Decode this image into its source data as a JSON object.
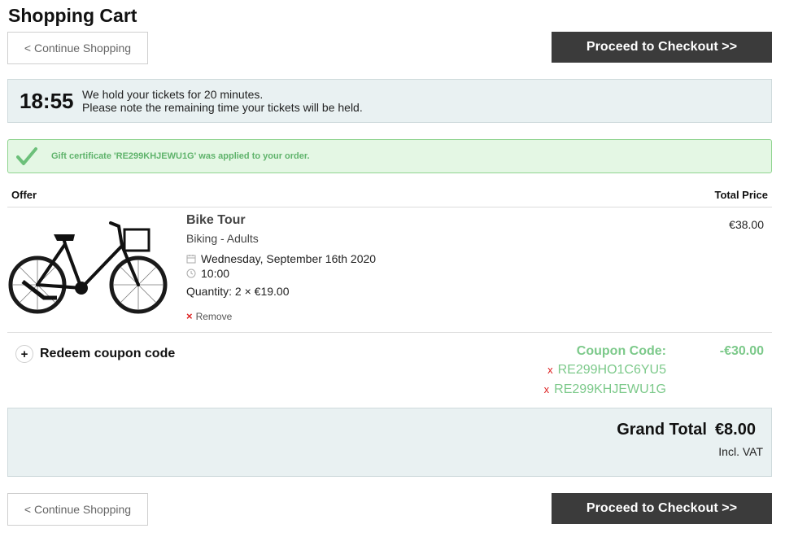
{
  "page": {
    "title": "Shopping Cart"
  },
  "nav": {
    "continue_label": "< Continue Shopping",
    "checkout_label": "Proceed to Checkout >>"
  },
  "timer": {
    "value": "18:55",
    "line1": "We hold your tickets for 20 minutes.",
    "line2": "Please note the remaining time your tickets will be held."
  },
  "alert": {
    "icon": "checkmark-icon",
    "message": "Gift certificate 'RE299KHJEWU1G' was applied to your order."
  },
  "table": {
    "col_offer": "Offer",
    "col_total": "Total Price"
  },
  "item": {
    "image": "bicycle-image",
    "title": "Bike Tour",
    "subtitle": "Biking - Adults",
    "date": "Wednesday, September 16th 2020",
    "time": "10:00",
    "quantity": "Quantity: 2 × €19.00",
    "remove_label": "Remove",
    "price": "€38.00"
  },
  "coupon": {
    "toggle_symbol": "+",
    "toggle_label": "Redeem coupon code",
    "label": "Coupon Code:",
    "amount": "-€30.00",
    "remove_symbol": "x",
    "codes": [
      "RE299HO1C6YU5",
      "RE299KHJEWU1G"
    ]
  },
  "totals": {
    "grand_label": "Grand Total",
    "grand_value": "€8.00",
    "vat_note": "Incl. VAT"
  },
  "colors": {
    "accent_green": "#7cc98a",
    "dark_button": "#3b3b3b",
    "panel_bg": "#e9f1f2",
    "remove_red": "#d22222"
  }
}
